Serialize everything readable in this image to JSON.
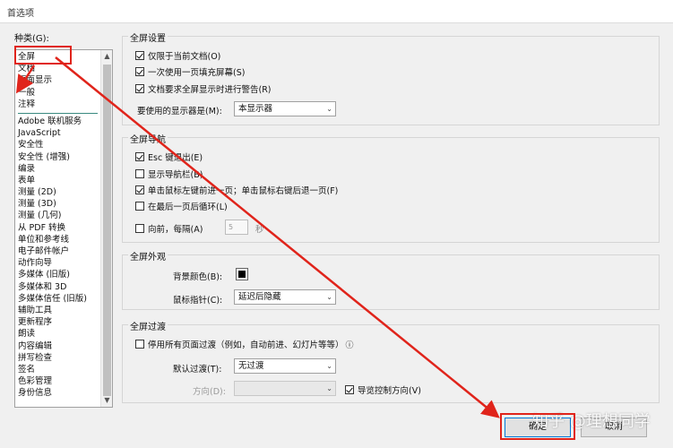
{
  "window": {
    "title": "首选项"
  },
  "categories": {
    "label": "种类(G):",
    "top_items": [
      "全屏",
      "文档",
      "页面显示",
      "一般",
      "注释"
    ],
    "items": [
      "Adobe 联机服务",
      "JavaScript",
      "安全性",
      "安全性 (增强)",
      "编录",
      "表单",
      "测量 (2D)",
      "测量 (3D)",
      "测量 (几何)",
      "从 PDF 转换",
      "单位和参考线",
      "电子邮件帐户",
      "动作向导",
      "多媒体 (旧版)",
      "多媒体和 3D",
      "多媒体信任 (旧版)",
      "辅助工具",
      "更新程序",
      "朗读",
      "内容编辑",
      "拼写检查",
      "签名",
      "色彩管理",
      "身份信息"
    ]
  },
  "fullscreen_setup": {
    "title": "全屏设置",
    "opt1": "仅限于当前文档(O)",
    "opt2": "一次使用一页填充屏幕(S)",
    "opt3": "文档要求全屏显示时进行警告(R)",
    "monitor_label": "要使用的显示器是(M):",
    "monitor_value": "本显示器"
  },
  "fullscreen_nav": {
    "title": "全屏导航",
    "opt1": "Esc 键退出(E)",
    "opt2": "显示导航栏(B)",
    "opt3": "单击鼠标左键前进一页；单击鼠标右键后退一页(F)",
    "opt4": "在最后一页后循环(L)",
    "opt5": "向前，每隔(A)",
    "interval": "5",
    "unit": "秒"
  },
  "fullscreen_look": {
    "title": "全屏外观",
    "bg_label": "背景颜色(B):",
    "bg_color": "#000000",
    "cursor_label": "鼠标指针(C):",
    "cursor_value": "延迟后隐藏"
  },
  "fullscreen_transition": {
    "title": "全屏过渡",
    "ignore": "停用所有页面过渡（例如，自动前进、幻灯片等等）",
    "info": "ⓘ",
    "default_label": "默认过渡(T):",
    "default_value": "无过渡",
    "direction_label": "方向(D):",
    "nav_dir": "导览控制方向(V)"
  },
  "buttons": {
    "ok": "确定",
    "cancel": "取消"
  },
  "watermark": "知乎 @理想同学",
  "annotation_color": "#e0241b"
}
